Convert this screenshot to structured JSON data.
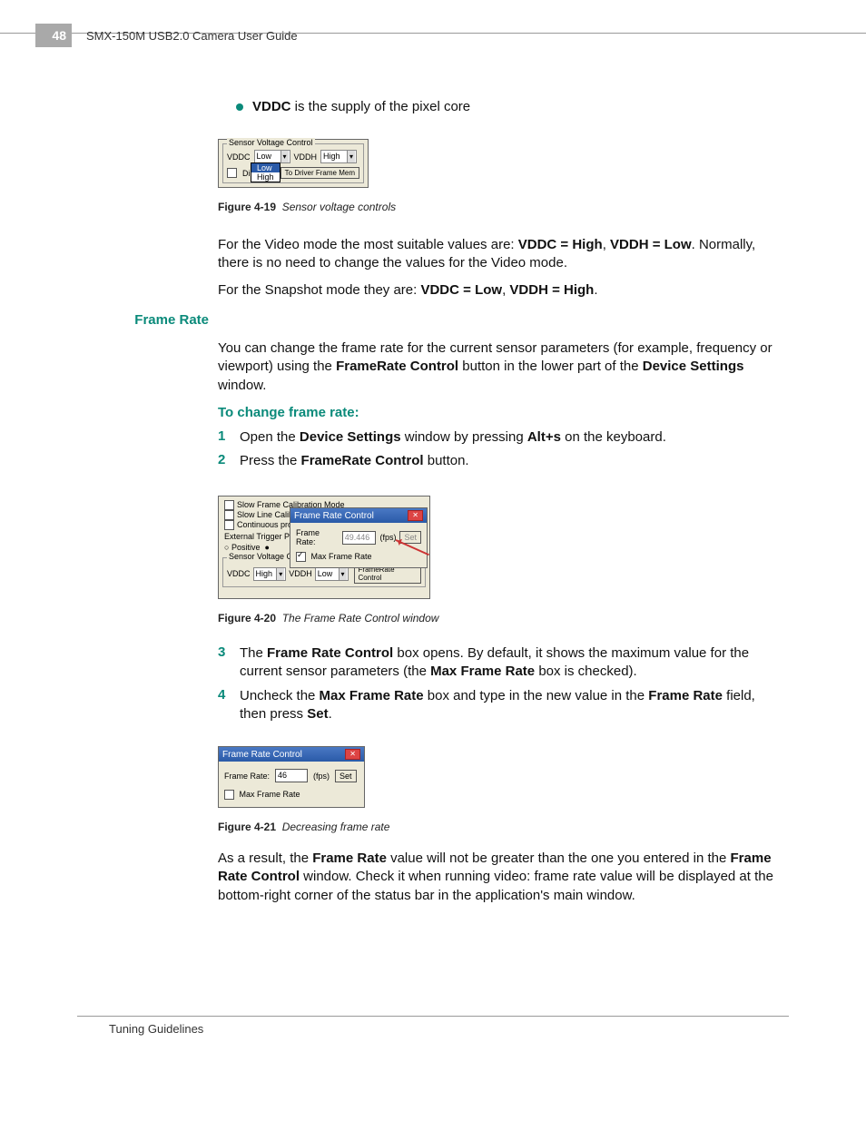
{
  "header": {
    "page_number": "48",
    "doc_title": "SMX-150M USB2.0 Camera User Guide"
  },
  "bullet": {
    "term": "VDDC",
    "rest": " is the supply of the pixel core"
  },
  "fig19": {
    "group_title": "Sensor Voltage Control",
    "vddc_label": "VDDC",
    "vddc_value": "Low",
    "vddh_label": "VDDH",
    "vddh_value": "High",
    "dd_opt_low": "Low",
    "dd_opt_high": "High",
    "direct_label": "Direct",
    "btn_todriver": "To Driver Frame Mem",
    "caption_b": "Figure 4-19",
    "caption_i": "Sensor voltage controls"
  },
  "para1_a": "For the Video mode the most suitable values are: ",
  "para1_b": "VDDC = High",
  "para1_c": ", ",
  "para1_d": "VDDH = Low",
  "para1_e": ". Normally, there is no need to change the values for the Video mode.",
  "para2_a": "For the Snapshot mode they are: ",
  "para2_b": "VDDC = Low",
  "para2_c": ", ",
  "para2_d": "VDDH = High",
  "para2_e": ".",
  "side_heading": "Frame Rate",
  "para3_a": "You can change the frame rate for the current sensor parameters (for example, frequency or viewport) using the ",
  "para3_b": "FrameRate Control",
  "para3_c": " button in the lower part of the ",
  "para3_d": "Device Settings",
  "para3_e": " window.",
  "subheading": "To change frame rate:",
  "step1_a": "Open the ",
  "step1_b": "Device Settings",
  "step1_c": " window by pressing ",
  "step1_d": "Alt+s",
  "step1_e": " on the keyboard.",
  "step2_a": "Press the ",
  "step2_b": "FrameRate Control",
  "step2_c": " button.",
  "n1": "1",
  "n2": "2",
  "n3": "3",
  "n4": "4",
  "fig20": {
    "chk_slowframe": "Slow Frame Calibration Mode",
    "chk_slowline": "Slow Line Calib",
    "chk_continuous": "Continuous pro",
    "ext_trigger": "External Trigger P",
    "rad_positive": "Positive",
    "group_svc": "Sensor Voltage Control",
    "vddc_label": "VDDC",
    "vddc_value": "High",
    "vddh_label": "VDDH",
    "vddh_value": "Low",
    "btn_framerate": "FrameRate Control",
    "dlg_title": "Frame Rate Control",
    "fr_label": "Frame Rate:",
    "fr_value": "49.446",
    "fr_unit": "(fps)",
    "btn_set": "Set",
    "chk_max": "Max Frame Rate",
    "caption_b": "Figure 4-20",
    "caption_i": "The Frame Rate Control window"
  },
  "step3_a": "The ",
  "step3_b": "Frame Rate Control",
  "step3_c": " box opens. By default, it shows the maximum value for the current sensor parameters (the ",
  "step3_d": "Max Frame Rate",
  "step3_e": " box is checked).",
  "step4_a": "Uncheck the ",
  "step4_b": "Max Frame Rate",
  "step4_c": " box and type in the new value in the ",
  "step4_d": "Frame Rate",
  "step4_e": " field, then press ",
  "step4_f": "Set",
  "step4_g": ".",
  "fig21": {
    "dlg_title": "Frame Rate Control",
    "fr_label": "Frame Rate:",
    "fr_value": "46",
    "fr_unit": "(fps)",
    "btn_set": "Set",
    "chk_max": "Max Frame Rate",
    "caption_b": "Figure 4-21",
    "caption_i": "Decreasing frame rate"
  },
  "para4_a": "As a result, the ",
  "para4_b": "Frame Rate",
  "para4_c": " value will not be greater than the one you entered in the ",
  "para4_d": "Frame Rate Control",
  "para4_e": " window. Check it when running video: frame rate value will be displayed at the bottom-right corner of the status bar in the application's main window.",
  "footer": "Tuning Guidelines"
}
